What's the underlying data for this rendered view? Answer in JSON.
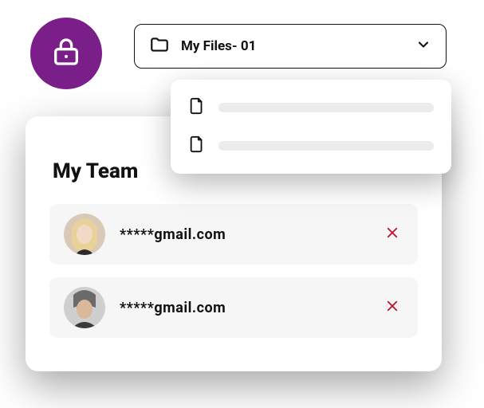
{
  "colors": {
    "lock_badge_bg": "#7a1f8a",
    "remove_icon": "#c0152f"
  },
  "folder_select": {
    "label": "My Files- 01"
  },
  "team": {
    "title": "My Team",
    "members": [
      {
        "email": "*****gmail.com"
      },
      {
        "email": "*****gmail.com"
      }
    ]
  }
}
